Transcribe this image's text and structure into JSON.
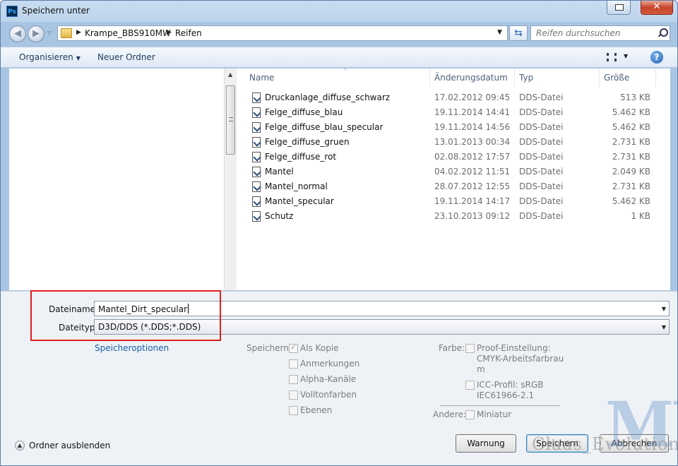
{
  "window": {
    "title": "Speichern unter",
    "close_glyph": "✕",
    "app_icon": "Ps"
  },
  "address": {
    "breadcrumb": [
      "Krampe_BBS910MW",
      "Reifen"
    ],
    "search_placeholder": "Reifen durchsuchen"
  },
  "toolbar": {
    "organize": "Organisieren",
    "new_folder": "Neuer Ordner",
    "help": "?"
  },
  "columns": {
    "name": "Name",
    "date": "Änderungsdatum",
    "type": "Typ",
    "size": "Größe"
  },
  "files": [
    {
      "name": "Druckanlage_diffuse_schwarz",
      "date": "17.02.2012 09:45",
      "type": "DDS-Datei",
      "size": "513 KB"
    },
    {
      "name": "Felge_diffuse_blau",
      "date": "19.11.2014 14:41",
      "type": "DDS-Datei",
      "size": "5.462 KB"
    },
    {
      "name": "Felge_diffuse_blau_specular",
      "date": "19.11.2014 14:56",
      "type": "DDS-Datei",
      "size": "5.462 KB"
    },
    {
      "name": "Felge_diffuse_gruen",
      "date": "13.01.2013 00:34",
      "type": "DDS-Datei",
      "size": "2.731 KB"
    },
    {
      "name": "Felge_diffuse_rot",
      "date": "02.08.2012 17:57",
      "type": "DDS-Datei",
      "size": "2.731 KB"
    },
    {
      "name": "Mantel",
      "date": "04.02.2012 11:51",
      "type": "DDS-Datei",
      "size": "2.049 KB"
    },
    {
      "name": "Mantel_normal",
      "date": "28.07.2012 12:55",
      "type": "DDS-Datei",
      "size": "2.731 KB"
    },
    {
      "name": "Mantel_specular",
      "date": "19.11.2014 14:17",
      "type": "DDS-Datei",
      "size": "5.462 KB"
    },
    {
      "name": "Schutz",
      "date": "23.10.2013 09:12",
      "type": "DDS-Datei",
      "size": "1 KB"
    }
  ],
  "form": {
    "filename_label": "Dateiname:",
    "filename_value": "Mantel_Dirt_specular",
    "filetype_label": "Dateityp:",
    "filetype_value": "D3D/DDS (*.DDS;*.DDS)"
  },
  "options": {
    "link": "Speicheroptionen",
    "save_label": "Speichern:",
    "save_checks": [
      "Als Kopie",
      "Anmerkungen",
      "Alpha-Kanäle",
      "Volltonfarben",
      "Ebenen"
    ],
    "color_label": "Farbe:",
    "proof_line1": "Proof-Einstellung:",
    "proof_line2": "CMYK-Arbeitsfarbrau",
    "proof_line3": "m",
    "icc_line1": "ICC-Profil: sRGB",
    "icc_line2": "IEC61966-2.1",
    "other_label": "Andere:",
    "thumbnail": "Miniatur"
  },
  "footer": {
    "hide_folders": "Ordner ausblenden",
    "warning_button": "Warnung",
    "save_button": "Speichern",
    "cancel_button": "Abbrechen"
  },
  "watermark": {
    "logo": "MW",
    "text": "Claas_Evolution"
  },
  "colors": {
    "highlight": "#e0201d",
    "link": "#1a5fa8",
    "title_bar": "#bcd3ec"
  }
}
